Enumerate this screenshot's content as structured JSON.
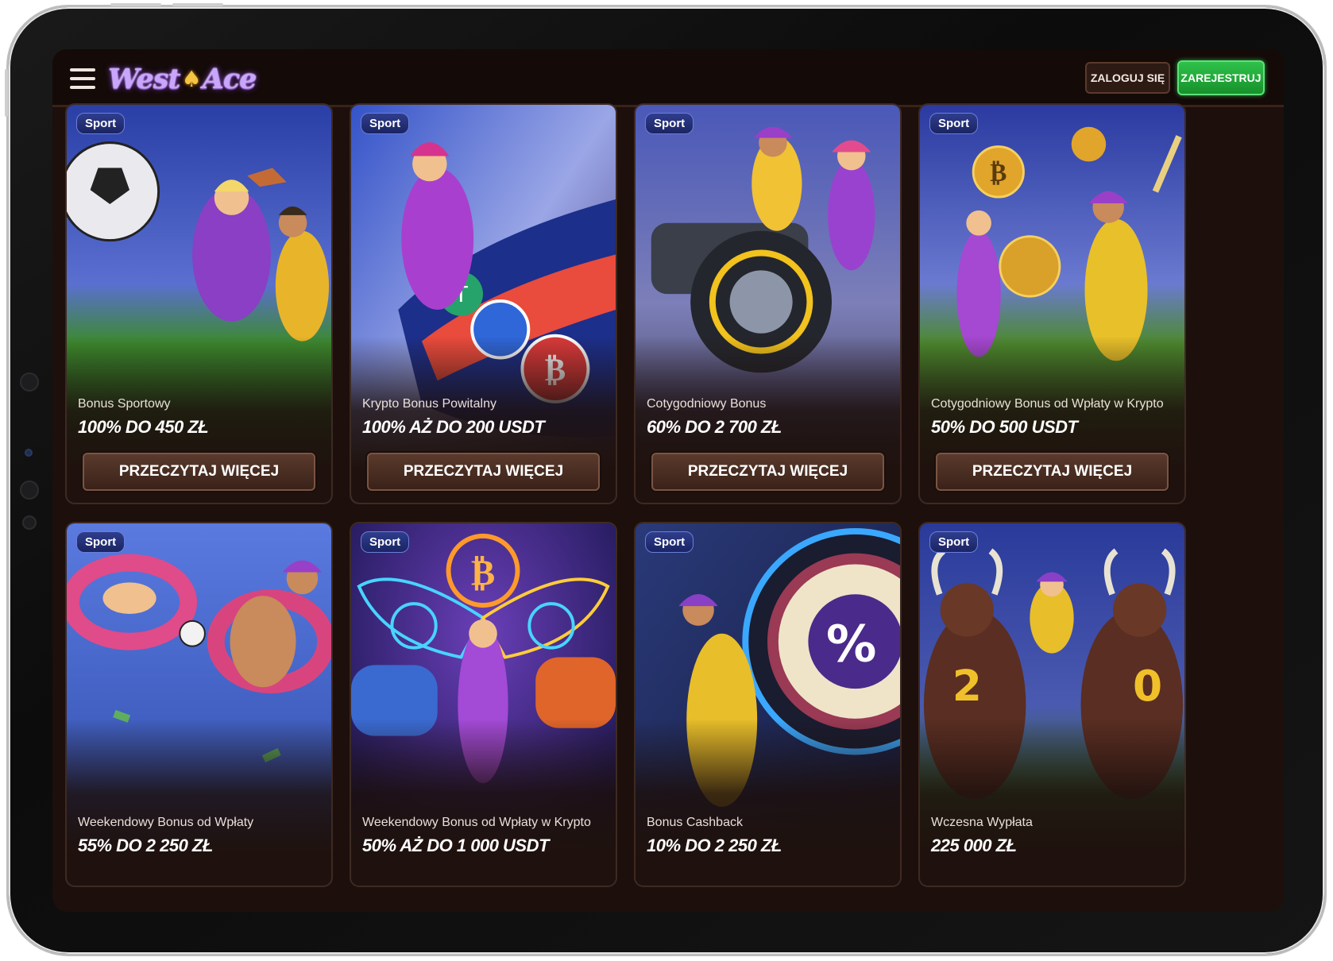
{
  "header": {
    "logo_text_left": "West",
    "logo_text_right": "Ace",
    "login_label": "ZALOGUJ SIĘ",
    "register_label": "ZAREJESTRUJ"
  },
  "colors": {
    "accent_green": "#22a83a",
    "badge_blue": "#2f3d8d",
    "button_brown": "#5a3a2c",
    "background": "#1c0f0c"
  },
  "cards": [
    {
      "badge": "Sport",
      "title": "Bonus Sportowy",
      "value": "100% DO 450 ZŁ",
      "button": "PRZECZYTAJ WIĘCEJ",
      "theme": "soccer"
    },
    {
      "badge": "Sport",
      "title": "Krypto Bonus Powitalny",
      "value": "100% AŻ DO 200 USDT",
      "button": "PRZECZYTAJ WIĘCEJ",
      "theme": "racing-car"
    },
    {
      "badge": "Sport",
      "title": "Cotygodniowy Bonus",
      "value": "60% DO 2 700 ZŁ",
      "button": "PRZECZYTAJ WIĘCEJ",
      "theme": "quad-bike"
    },
    {
      "badge": "Sport",
      "title": "Cotygodniowy Bonus od Wpłaty w Krypto",
      "value": "50% DO 500 USDT",
      "button": "PRZECZYTAJ WIĘCEJ",
      "theme": "baseball-crypto"
    },
    {
      "badge": "Sport",
      "title": "Weekendowy Bonus od Wpłaty",
      "value": "55% DO 2 250 ZŁ",
      "theme": "pool"
    },
    {
      "badge": "Sport",
      "title": "Weekendowy Bonus od Wpłaty w Krypto",
      "value": "50% AŻ DO 1 000 USDT",
      "theme": "crypto-wings"
    },
    {
      "badge": "Sport",
      "title": "Bonus Cashback",
      "value": "10% DO 2 250 ZŁ",
      "theme": "darts"
    },
    {
      "badge": "Sport",
      "title": "Wczesna Wypłata",
      "value": "225 000 ZŁ",
      "theme": "bulls"
    }
  ]
}
